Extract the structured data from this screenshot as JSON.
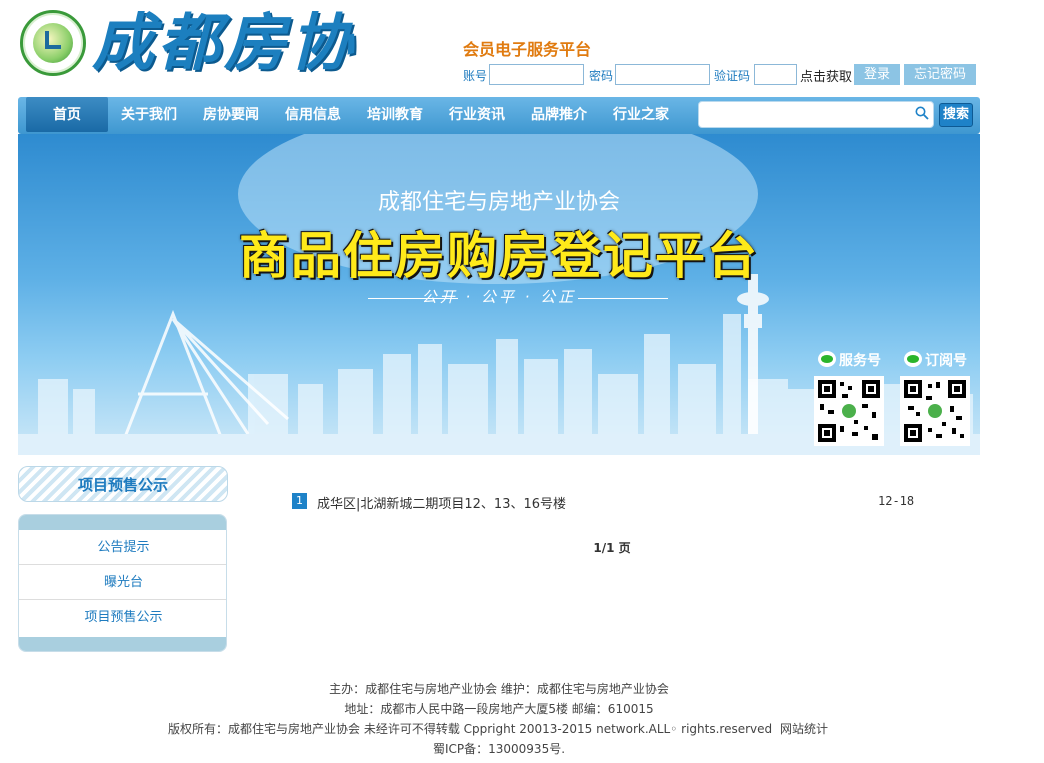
{
  "header": {
    "logo_text": "成都房协",
    "member_title": "会员电子服务平台",
    "account_label": "账号",
    "password_label": "密码",
    "captcha_label": "验证码",
    "get_code_label": "点击获取",
    "login_label": "登录",
    "forgot_label": "忘记密码"
  },
  "nav": {
    "items": [
      "首页",
      "关于我们",
      "房协要闻",
      "信用信息",
      "培训教育",
      "行业资讯",
      "品牌推介",
      "行业之家"
    ],
    "search_button": "搜索",
    "search_placeholder": ""
  },
  "banner": {
    "subtitle": "成都住宅与房地产业协会",
    "title": "商品住房购房登记平台",
    "slogan": "公开 · 公平 · 公正",
    "qr_service_label": "服务号",
    "qr_subscribe_label": "订阅号"
  },
  "sidebar": {
    "title": "项目预售公示",
    "items": [
      "公告提示",
      "曝光台",
      "项目预售公示"
    ]
  },
  "list": {
    "items": [
      {
        "index": "1",
        "text": "成华区|北湖新城二期项目12、13、16号楼",
        "date": "12-18"
      }
    ],
    "pager": "1/1 页"
  },
  "footer": {
    "line1": "主办：成都住宅与房地产业协会 维护：成都住宅与房地产业协会",
    "line2": "地址：成都市人民中路一段房地产大厦5楼 邮编：610015",
    "line3": "版权所有：成都住宅与房地产业协会 未经许可不得转载 Cppright 20013-2015 network.ALL◦ rights.reserved",
    "stats_link": "网站统计",
    "icp": "蜀ICP备：13000935号."
  },
  "colors": {
    "accent": "#1e82c8",
    "nav_bg": "#4ea4da",
    "title_orange": "#e07b10",
    "banner_title_yellow": "#ffea1a"
  }
}
